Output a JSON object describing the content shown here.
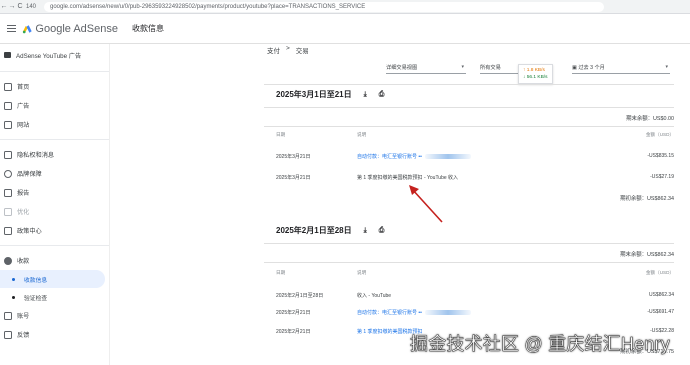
{
  "browser": {
    "back": "←",
    "forward": "→",
    "reload": "C",
    "tab_count": "140",
    "url": "google.com/adsense/new/u/0/pub-2963593224928502/payments/product/youtube?place=TRANSACTIONS_SERVICE"
  },
  "header": {
    "logo_google": "Google",
    "logo_adsense": "AdSense",
    "title": "收款信息"
  },
  "sidebar": {
    "account": "AdSense YouTube 广告",
    "items": [
      {
        "label": "首页",
        "icon": "home-icon"
      },
      {
        "label": "广告",
        "icon": "ads-icon"
      },
      {
        "label": "网站",
        "icon": "sites-icon"
      },
      {
        "label": "隐私权和消息",
        "icon": "privacy-icon"
      },
      {
        "label": "品牌保障",
        "icon": "brand-safety-icon"
      },
      {
        "label": "报告",
        "icon": "reports-icon"
      },
      {
        "label": "优化",
        "icon": "optimize-icon"
      },
      {
        "label": "政策中心",
        "icon": "policy-icon"
      },
      {
        "label": "收款",
        "icon": "payments-icon"
      },
      {
        "label": "账号",
        "icon": "account-icon"
      },
      {
        "label": "反馈",
        "icon": "feedback-icon"
      }
    ],
    "sub_items": [
      {
        "label": "收款信息"
      },
      {
        "label": "验证检查"
      }
    ]
  },
  "breadcrumb": {
    "parent": "支付",
    "separator": ">",
    "current": "交易"
  },
  "filters": {
    "view": "详细交易视图",
    "type": "所有交易",
    "period": "过去 3 个月"
  },
  "tooltip": {
    "line1": "↑ 1.8 KB/s",
    "line2": "↓ 56.1 KB/s"
  },
  "section1": {
    "title": "2025年3月1日至21日",
    "opening_label": "期末余额：US$0.00",
    "col_date": "日期",
    "col_desc": "说明",
    "col_amount": "金额（USD）",
    "rows": [
      {
        "date": "2025年3月21日",
        "desc": "自动付款：电汇至银行账号 ••",
        "amount": "-US$835.15"
      },
      {
        "date": "2025年3月21日",
        "desc": "第 1 季度扣缴的美国税款预扣 - YouTube 收入",
        "amount": "-US$27.19"
      }
    ],
    "closing": "期初余额：US$862.34"
  },
  "section2": {
    "title": "2025年2月1日至28日",
    "opening_label": "期末余额：US$862.34",
    "col_date": "日期",
    "col_desc": "说明",
    "col_amount": "金额（USD）",
    "rows": [
      {
        "date": "2025年2月1日至28日",
        "desc": "收入 - YouTube",
        "amount": "US$862.34"
      },
      {
        "date": "2025年2月21日",
        "desc": "自动付款：电汇至银行账号 ••",
        "amount": "-US$691.47"
      },
      {
        "date": "2025年2月21日",
        "desc": "第 1 季度扣缴的美国税款预扣",
        "amount": "-US$22.28"
      }
    ],
    "closing": "期初余额：US$713.75"
  },
  "watermark": "掘金技术社区 @ 重庆结汇Henry",
  "colors": {
    "accent": "#1a73e8",
    "active_bg": "#e8f0fe",
    "arrow": "#c5221f"
  }
}
